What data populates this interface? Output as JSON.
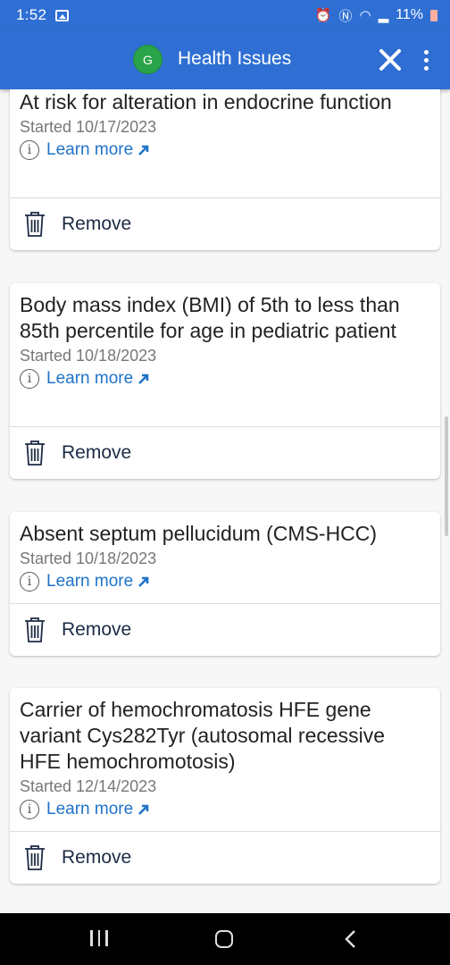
{
  "status_bar": {
    "time": "1:52",
    "battery_percent": "11%",
    "icons": [
      "gallery-icon",
      "alarm-icon",
      "nfc-icon",
      "wifi-icon",
      "signal-icon",
      "battery-icon"
    ]
  },
  "app_bar": {
    "avatar_initial": "G",
    "title": "Health Issues",
    "close_icon": "close-icon",
    "menu_icon": "more-vert-icon"
  },
  "issues": [
    {
      "title": "At risk for alteration in endocrine function",
      "started": "Started 10/17/2023",
      "learn_more": "Learn more",
      "remove": "Remove"
    },
    {
      "title": "Body mass index (BMI) of 5th to less than 85th percentile for age in pediatric patient",
      "started": "Started 10/18/2023",
      "learn_more": "Learn more",
      "remove": "Remove"
    },
    {
      "title": "Absent septum pellucidum (CMS-HCC)",
      "started": "Started 10/18/2023",
      "learn_more": "Learn more",
      "remove": "Remove"
    },
    {
      "title": "Carrier of hemochromatosis HFE gene variant Cys282Tyr (autosomal recessive HFE hemochromotosis)",
      "started": "Started 12/14/2023",
      "learn_more": "Learn more",
      "remove": "Remove"
    }
  ],
  "colors": {
    "app_bar": "#2f6fd3",
    "avatar": "#2aa44a",
    "link": "#1f73c9",
    "remove_text": "#1d2b44"
  },
  "nav_bar": {
    "icons": [
      "recents-icon",
      "home-icon",
      "back-icon"
    ]
  }
}
